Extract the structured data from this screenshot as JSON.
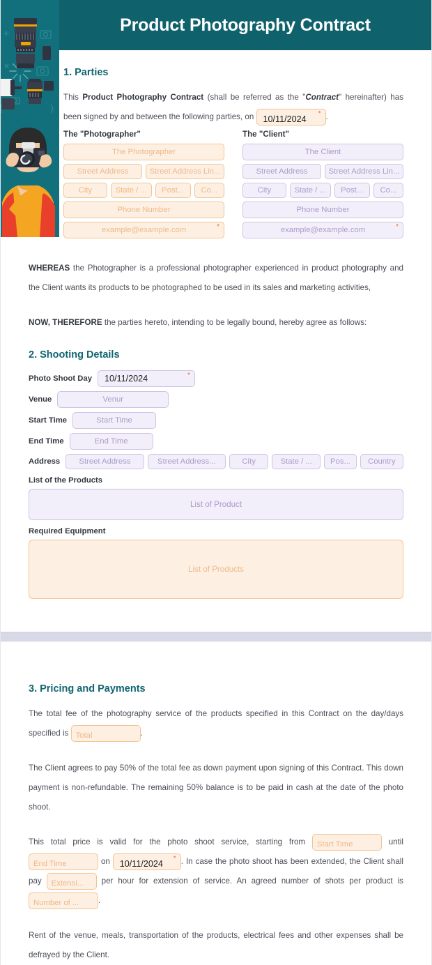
{
  "header": {
    "title": "Product Photography Contract",
    "banner_color": "#0f616c",
    "illustration": "photographer-camera-illustration"
  },
  "theme": {
    "heading_color": "#0f6570",
    "body_text_color": "#4a4e57",
    "purple_field_bg": "#f3effa",
    "purple_field_border": "#cdc3e6",
    "purple_field_text": "#a99ccb",
    "orange_field_bg": "#fdf0e3",
    "orange_field_border": "#f3c493",
    "orange_field_text": "#efb888",
    "required_marker_color": "#ef6c3a",
    "page_break_color": "#d8d8e6"
  },
  "sections": {
    "parties": {
      "heading": "1. Parties",
      "intro_pre": "This ",
      "intro_bold": "Product Photography Contract",
      "intro_mid": " (shall be referred as the \"",
      "intro_italic": "Contract",
      "intro_post": "\" hereinafter) has been signed by and between the following parties, on",
      "intro_end": ".",
      "date_value": "10/11/2024",
      "required_marker": "*",
      "photographer": {
        "title": "The \"Photographer\"",
        "name": "The Photographer",
        "street1": "Street Address",
        "street2": "Street Address Lin...",
        "city": "City",
        "state": "State / ...",
        "postal": "Post...",
        "country": "Co...",
        "phone": "Phone Number",
        "email": "example@example.com"
      },
      "client": {
        "title": "The \"Client\"",
        "name": "The Client",
        "street1": "Street Address",
        "street2": "Street Address Lin...",
        "city": "City",
        "state": "State / ...",
        "postal": "Post...",
        "country": "Co...",
        "phone": "Phone Number",
        "email": "example@example.com"
      }
    },
    "recitals": {
      "whereas_bold": "WHEREAS",
      "whereas_text": " the Photographer is a professional photographer experienced in product photography and the Client wants its products to be photographed to be used in its sales and marketing activities,",
      "therefore_bold": "NOW, THEREFORE",
      "therefore_text": " the parties hereto, intending to be legally bound, hereby agree as follows:"
    },
    "shooting": {
      "heading": "2. Shooting Details",
      "labels": {
        "photo_shoot_day": "Photo Shoot Day",
        "venue": "Venue",
        "start_time": "Start Time",
        "end_time": "End Time",
        "address": "Address",
        "list_of_products": "List of the Products",
        "required_equipment": "Required Equipment"
      },
      "values": {
        "photo_shoot_day": "10/11/2024",
        "venue": "Venur",
        "start_time": "Start Time",
        "end_time": "End Time",
        "street1": "Street Address",
        "street2": "Street Address...",
        "city": "City",
        "state": "State / ...",
        "postal": "Pos...",
        "country": "Country",
        "list_of_products": "List of Product",
        "required_equipment": "List of Products"
      },
      "required_marker": "*"
    },
    "pricing": {
      "heading": "3. Pricing and Payments",
      "p1_pre": "The total fee of the photography service of the products specified in this Contract on the day/days specified is",
      "p1_field": "Total",
      "p1_post": ".",
      "p2": "The Client agrees to pay 50% of the total fee as down payment upon signing of this Contract. This down payment is non-refundable. The remaining 50% balance is to be paid in cash at the date of the photo shoot.",
      "p3_a": "This total price is valid for the photo shoot service, starting from",
      "p3_start_time": "Start Time",
      "p3_b": "until",
      "p3_end_time": "End Time",
      "p3_c": "on",
      "p3_date": "10/11/2024",
      "p3_d": ". In case the photo shoot has been extended, the Client shall pay",
      "p3_extension": "Extensi...",
      "p3_e": "per hour for extension of service. An agreed number of shots per product is",
      "p3_number": "Number of ...",
      "p3_f": ".",
      "required_marker": "*",
      "p4": "Rent of the venue, meals, transportation of the products, electrical fees and other expenses shall be defrayed by the Client."
    }
  }
}
